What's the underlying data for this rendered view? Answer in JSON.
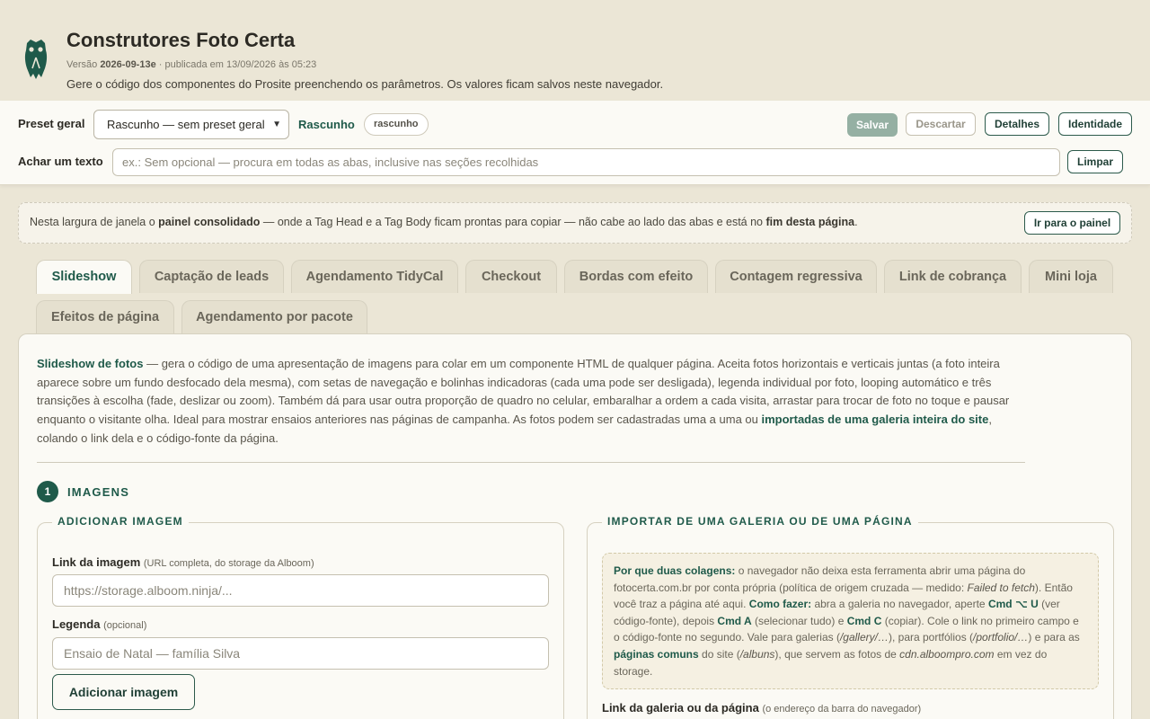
{
  "header": {
    "title": "Construtores Foto Certa",
    "version_prefix": "Versão ",
    "version": "2026-09-13e",
    "published": " · publicada em 13/09/2026 às 05:23",
    "subtitle": "Gere o código dos componentes do Prosite preenchendo os parâmetros. Os valores ficam salvos neste navegador.",
    "logo_icon": "owl-icon"
  },
  "toolbar": {
    "preset_label": "Preset geral",
    "preset_value": "Rascunho — sem preset geral",
    "draft_label": "Rascunho",
    "draft_badge": "rascunho",
    "save": "Salvar",
    "discard": "Descartar",
    "details": "Detalhes",
    "identity": "Identidade",
    "search_label": "Achar um texto",
    "search_placeholder": "ex.: Sem opcional — procura em todas as abas, inclusive nas seções recolhidas",
    "clear": "Limpar"
  },
  "notice": {
    "p1": "Nesta largura de janela o ",
    "b1": "painel consolidado",
    "p2": " — onde a Tag Head e a Tag Body ficam prontas para copiar — não cabe ao lado das abas e está no ",
    "b2": "fim desta página",
    "p3": ".",
    "button": "Ir para o painel"
  },
  "tabs": [
    "Slideshow",
    "Captação de leads",
    "Agendamento TidyCal",
    "Checkout",
    "Bordas com efeito",
    "Contagem regressiva",
    "Link de cobrança",
    "Mini loja",
    "Efeitos de página",
    "Agendamento por pacote"
  ],
  "active_tab": "Slideshow",
  "intro": {
    "strong1": "Slideshow de fotos",
    "text1": " — gera o código de uma apresentação de imagens para colar em um componente HTML de qualquer página. Aceita fotos horizontais e verticais juntas (a foto inteira aparece sobre um fundo desfocado dela mesma), com setas de navegação e bolinhas indicadoras (cada uma pode ser desligada), legenda individual por foto, looping automático e três transições à escolha (fade, deslizar ou zoom). Também dá para usar outra proporção de quadro no celular, embaralhar a ordem a cada visita, arrastar para trocar de foto no toque e pausar enquanto o visitante olha. Ideal para mostrar ensaios anteriores nas páginas de campanha. As fotos podem ser cadastradas uma a uma ou ",
    "strong2": "importadas de uma galeria inteira do site",
    "text2": ", colando o link dela e o código-fonte da página."
  },
  "step": {
    "number": "1",
    "title": "IMAGENS"
  },
  "add_image": {
    "legend": "ADICIONAR IMAGEM",
    "link_label": "Link da imagem",
    "link_hint": "(URL completa, do storage da Alboom)",
    "link_placeholder": "https://storage.alboom.ninja/...",
    "caption_label": "Legenda",
    "caption_hint": "(opcional)",
    "caption_placeholder": "Ensaio de Natal — família Silva",
    "button": "Adicionar imagem"
  },
  "import": {
    "legend": "IMPORTAR DE UMA GALERIA OU DE UMA PÁGINA",
    "why_title": "Por que duas colagens:",
    "why_t1": " o navegador não deixa esta ferramenta abrir uma página do fotocerta.com.br por conta própria (política de origem cruzada — medido: ",
    "why_err": "Failed to fetch",
    "why_t2": "). Então você traz a página até aqui. ",
    "how_title": "Como fazer:",
    "how_t1": " abra a galeria no navegador, aperte ",
    "key1": "Cmd ⌥ U",
    "how_t2": " (ver código-fonte), depois ",
    "key2": "Cmd A",
    "how_t3": " (selecionar tudo) e ",
    "key3": "Cmd C",
    "how_t4": " (copiar). Cole o link no primeiro campo e o código-fonte no segundo. Vale para galerias (",
    "path1": "/gallery/…",
    "how_t5": "), para portfólios (",
    "path2": "/portfolio/…",
    "how_t6": ") e para as ",
    "pages": "páginas comuns",
    "how_t7": " do site (",
    "path3": "/albuns",
    "how_t8": "), que servem as fotos de ",
    "cdn": "cdn.alboompro.com",
    "how_t9": " em vez do storage.",
    "gallery_label": "Link da galeria ou da página",
    "gallery_hint": "(o endereço da barra do navegador)"
  },
  "colors": {
    "accent": "#1f5a4a",
    "background": "#ebe6d6",
    "surface": "#fbfaf5"
  }
}
